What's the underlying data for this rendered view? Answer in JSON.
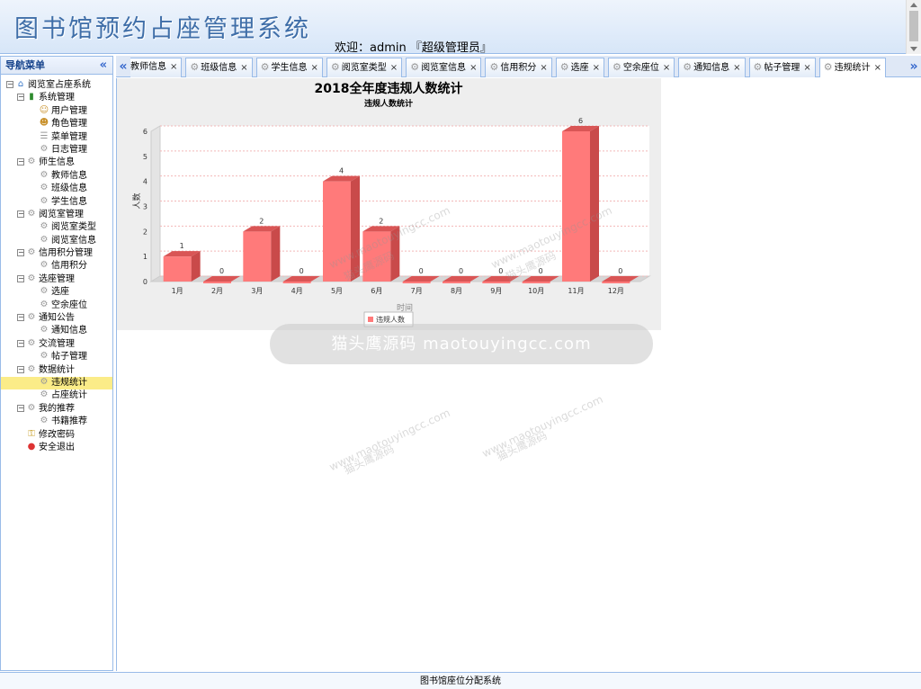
{
  "header": {
    "title": "图书馆预约占座管理系统",
    "welcome": "欢迎：admin 『超级管理员』"
  },
  "sidebar": {
    "title": "导航菜单",
    "collapse_glyph": "«",
    "tree": [
      {
        "label": "阅览室占座系统",
        "level": 0,
        "icon": "home-icon"
      },
      {
        "label": "系统管理",
        "level": 1,
        "icon": "book-icon"
      },
      {
        "label": "用户管理",
        "level": 2,
        "icon": "user-icon"
      },
      {
        "label": "角色管理",
        "level": 2,
        "icon": "users-icon"
      },
      {
        "label": "菜单管理",
        "level": 2,
        "icon": "menu-icon"
      },
      {
        "label": "日志管理",
        "level": 2,
        "icon": "gear-icon"
      },
      {
        "label": "师生信息",
        "level": 1,
        "icon": "gear-icon"
      },
      {
        "label": "教师信息",
        "level": 2,
        "icon": "gear-icon"
      },
      {
        "label": "班级信息",
        "level": 2,
        "icon": "gear-icon"
      },
      {
        "label": "学生信息",
        "level": 2,
        "icon": "gear-icon"
      },
      {
        "label": "阅览室管理",
        "level": 1,
        "icon": "gear-icon"
      },
      {
        "label": "阅览室类型",
        "level": 2,
        "icon": "gear-icon"
      },
      {
        "label": "阅览室信息",
        "level": 2,
        "icon": "gear-icon"
      },
      {
        "label": "信用积分管理",
        "level": 1,
        "icon": "gear-icon"
      },
      {
        "label": "信用积分",
        "level": 2,
        "icon": "gear-icon"
      },
      {
        "label": "选座管理",
        "level": 1,
        "icon": "gear-icon"
      },
      {
        "label": "选座",
        "level": 2,
        "icon": "gear-icon"
      },
      {
        "label": "空余座位",
        "level": 2,
        "icon": "gear-icon"
      },
      {
        "label": "通知公告",
        "level": 1,
        "icon": "gear-icon"
      },
      {
        "label": "通知信息",
        "level": 2,
        "icon": "gear-icon"
      },
      {
        "label": "交流管理",
        "level": 1,
        "icon": "gear-icon"
      },
      {
        "label": "帖子管理",
        "level": 2,
        "icon": "gear-icon"
      },
      {
        "label": "数据统计",
        "level": 1,
        "icon": "gear-icon"
      },
      {
        "label": "违规统计",
        "level": 2,
        "icon": "gear-icon",
        "selected": true
      },
      {
        "label": "占座统计",
        "level": 2,
        "icon": "gear-icon"
      },
      {
        "label": "我的推荐",
        "level": 1,
        "icon": "gear-icon"
      },
      {
        "label": "书籍推荐",
        "level": 2,
        "icon": "gear-icon"
      },
      {
        "label": "修改密码",
        "level": 1,
        "icon": "lock-icon"
      },
      {
        "label": "安全退出",
        "level": 1,
        "icon": "exit-icon"
      }
    ]
  },
  "tabs": {
    "scroll_left": "«",
    "scroll_right": "»",
    "items": [
      {
        "label": "教师信息"
      },
      {
        "label": "班级信息"
      },
      {
        "label": "学生信息"
      },
      {
        "label": "阅览室类型"
      },
      {
        "label": "阅览室信息"
      },
      {
        "label": "信用积分"
      },
      {
        "label": "选座"
      },
      {
        "label": "空余座位"
      },
      {
        "label": "通知信息"
      },
      {
        "label": "帖子管理"
      },
      {
        "label": "违规统计",
        "active": true
      }
    ],
    "close_glyph": "×"
  },
  "chart_data": {
    "type": "bar",
    "title": "2018全年度违规人数统计",
    "subtitle": "违规人数统计",
    "xlabel": "时间",
    "ylabel": "人数",
    "categories": [
      "1月",
      "2月",
      "3月",
      "4月",
      "5月",
      "6月",
      "7月",
      "8月",
      "9月",
      "10月",
      "11月",
      "12月"
    ],
    "series": [
      {
        "name": "违规人数",
        "values": [
          1,
          0,
          2,
          0,
          4,
          2,
          0,
          0,
          0,
          0,
          6,
          0
        ]
      }
    ],
    "ylim": [
      0,
      6
    ],
    "yticks": [
      "0",
      "1",
      "2",
      "3",
      "4",
      "5",
      "6"
    ],
    "legend": "bottom-center",
    "colors": {
      "bar": "#ff7a7a",
      "bar_top": "#d95555",
      "bar_side": "#c94a4a",
      "grid": "#f2b8b8"
    }
  },
  "watermark": {
    "band_text": "猫头鹰源码 maotouyingcc.com",
    "small_texts": [
      "www.maotouyingcc.com",
      "猫头鹰源码"
    ]
  },
  "footer": {
    "text": "图书馆座位分配系统"
  }
}
